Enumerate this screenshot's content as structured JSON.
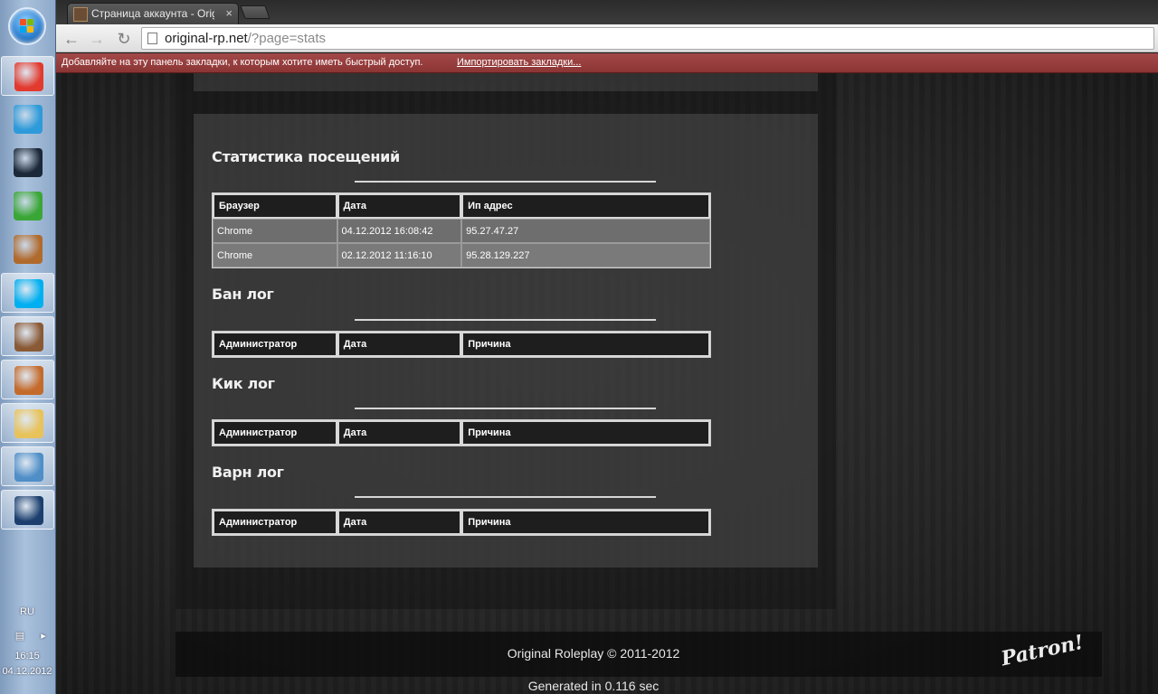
{
  "taskbar": {
    "apps": [
      {
        "name": "chrome-icon",
        "active": true,
        "color": "#e23a2e"
      },
      {
        "name": "download-manager-icon",
        "active": false,
        "color": "#2d9ad9"
      },
      {
        "name": "steam-icon",
        "active": false,
        "color": "#1b2838"
      },
      {
        "name": "qip-icon",
        "active": false,
        "color": "#3aa636"
      },
      {
        "name": "teddy-bear-icon",
        "active": false,
        "color": "#b06a2c"
      },
      {
        "name": "skype-icon",
        "active": true,
        "color": "#00aff0"
      },
      {
        "name": "game-character-icon",
        "active": true,
        "color": "#8a5a36"
      },
      {
        "name": "game-character-2-icon",
        "active": true,
        "color": "#c46a2a"
      },
      {
        "name": "explorer-folder-icon",
        "active": true,
        "color": "#e8c25a"
      },
      {
        "name": "picture-viewer-icon",
        "active": true,
        "color": "#4f8ec7"
      },
      {
        "name": "photoshop-icon",
        "active": true,
        "color": "#1c3f6e"
      }
    ],
    "language": "RU",
    "time": "16:15",
    "date": "04.12.2012"
  },
  "browser": {
    "tab_title": "Страница аккаунта - Orig",
    "url_host": "original-rp.net",
    "url_rest": "/?page=stats",
    "bookmark_message": "Добавляйте на эту панель закладки, к которым хотите иметь быстрый доступ.",
    "bookmark_link": "Импортировать закладки..."
  },
  "page": {
    "visits": {
      "title": "Статистика посещений",
      "headers": [
        "Браузер",
        "Дата",
        "Ип адрес"
      ],
      "rows": [
        [
          "Chrome",
          "04.12.2012 16:08:42",
          "95.27.47.27"
        ],
        [
          "Chrome",
          "02.12.2012 11:16:10",
          "95.28.129.227"
        ]
      ]
    },
    "ban_log": {
      "title": "Бан лог",
      "headers": [
        "Администратор",
        "Дата",
        "Причина"
      ]
    },
    "kick_log": {
      "title": "Кик лог",
      "headers": [
        "Администратор",
        "Дата",
        "Причина"
      ]
    },
    "warn_log": {
      "title": "Варн лог",
      "headers": [
        "Администратор",
        "Дата",
        "Причина"
      ]
    },
    "footer_copyright": "Original Roleplay © 2011-2012",
    "footer_logo": "Patron!",
    "generated": "Generated in 0.116 sec"
  }
}
